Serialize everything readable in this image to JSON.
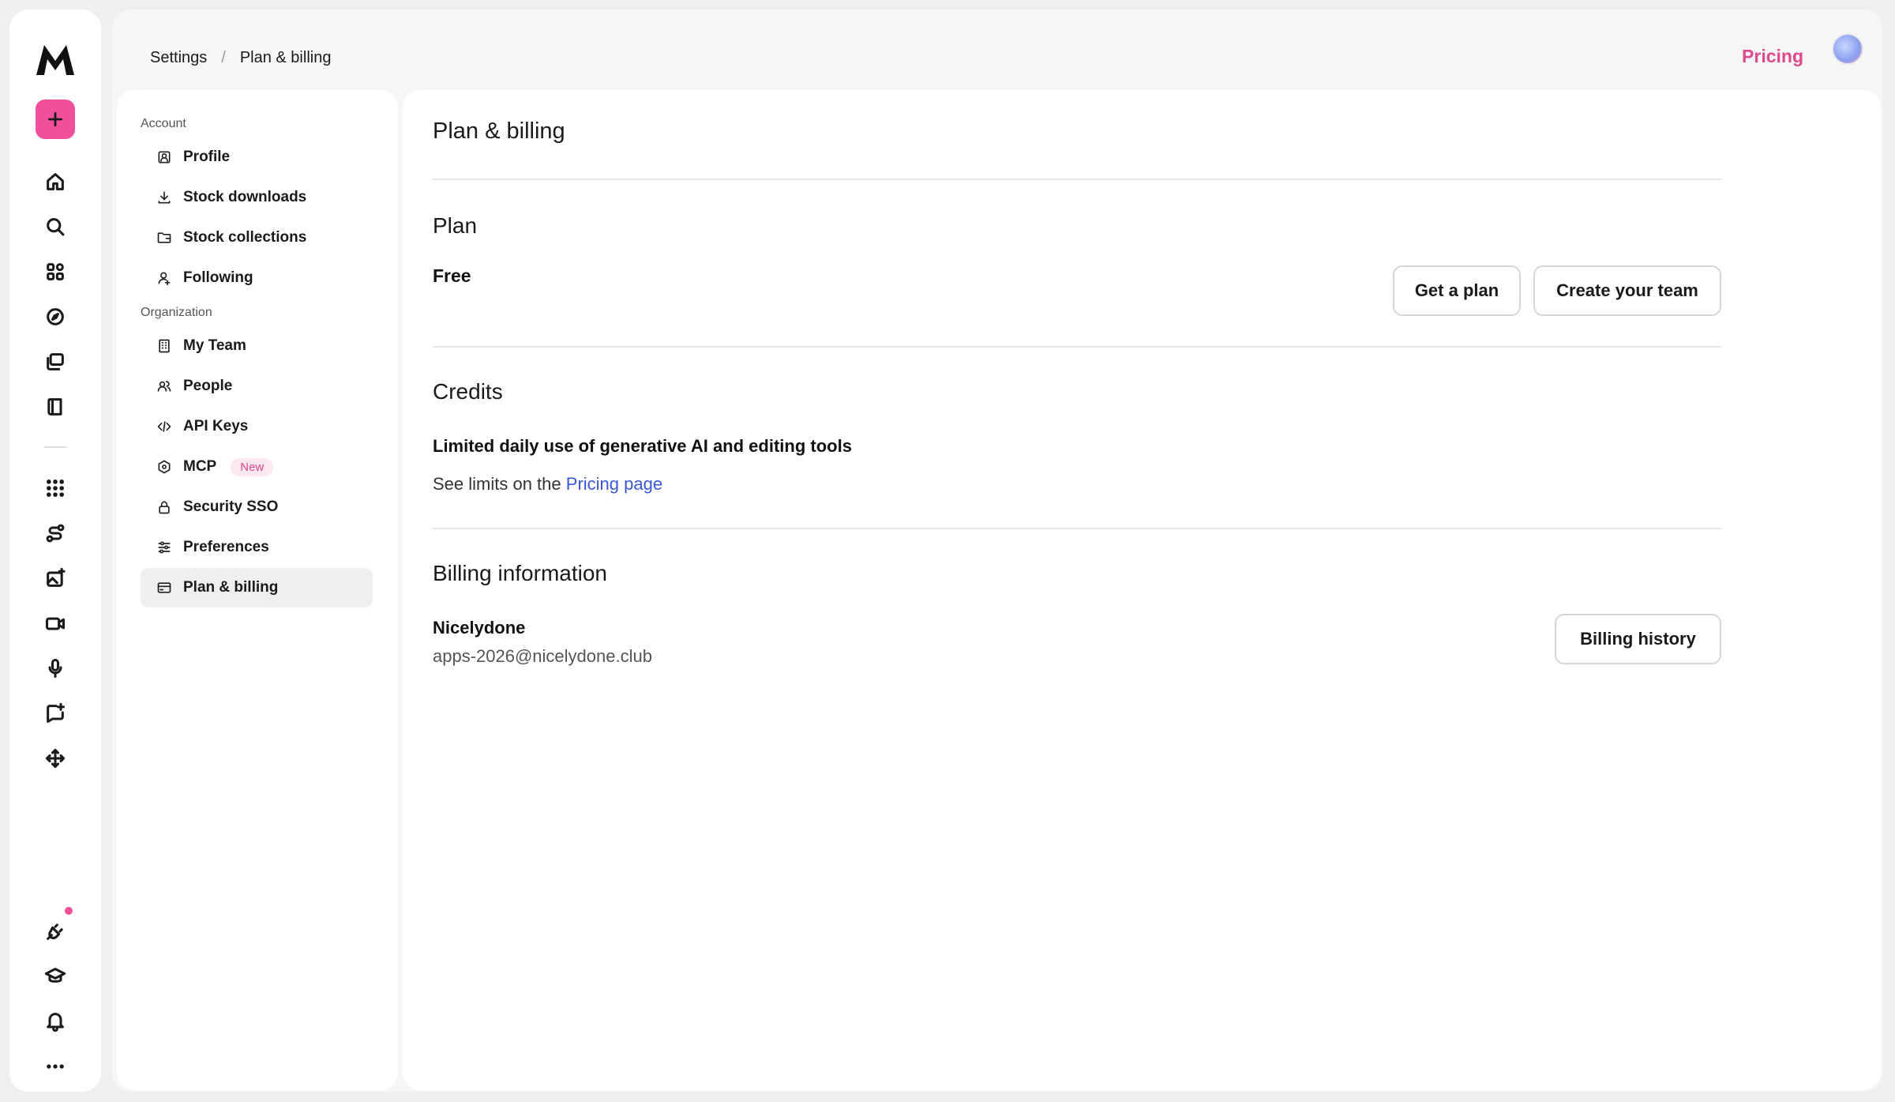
{
  "rail": {
    "top_icons": [
      "home-icon",
      "search-icon",
      "apps-grid-icon",
      "compass-icon",
      "collections-icon",
      "book-icon"
    ],
    "tool_icons": [
      "grid-dots-icon",
      "workflow-icon",
      "image-ai-icon",
      "video-ai-icon",
      "microphone-icon",
      "chat-ai-icon",
      "move-icon"
    ],
    "bottom_icons": [
      "plug-icon",
      "graduation-cap-icon",
      "bell-icon",
      "more-icon"
    ],
    "accent_color": "#f0509b"
  },
  "header": {
    "breadcrumb_root": "Settings",
    "breadcrumb_sep": "/",
    "breadcrumb_current": "Plan & billing",
    "pricing_label": "Pricing"
  },
  "subnav": {
    "account_label": "Account",
    "account_items": [
      {
        "label": "Profile",
        "icon": "profile-icon"
      },
      {
        "label": "Stock downloads",
        "icon": "download-icon"
      },
      {
        "label": "Stock collections",
        "icon": "folder-icon"
      },
      {
        "label": "Following",
        "icon": "user-follow-icon"
      }
    ],
    "org_label": "Organization",
    "org_items": [
      {
        "label": "My Team",
        "icon": "building-icon"
      },
      {
        "label": "People",
        "icon": "people-icon"
      },
      {
        "label": "API Keys",
        "icon": "code-icon"
      },
      {
        "label": "MCP",
        "icon": "hexagon-icon",
        "badge": "New"
      },
      {
        "label": "Security SSO",
        "icon": "lock-icon"
      },
      {
        "label": "Preferences",
        "icon": "sliders-icon"
      },
      {
        "label": "Plan & billing",
        "icon": "card-icon",
        "active": true
      }
    ]
  },
  "main": {
    "title": "Plan & billing",
    "plan": {
      "heading": "Plan",
      "current": "Free",
      "get_plan_label": "Get a plan",
      "create_team_label": "Create your team"
    },
    "credits": {
      "heading": "Credits",
      "description": "Limited daily use of generative AI and editing tools",
      "limits_prefix": "See limits on the",
      "limits_link": "Pricing page"
    },
    "billing": {
      "heading": "Billing information",
      "name": "Nicelydone",
      "email": "apps-2026@nicelydone.club",
      "history_label": "Billing history"
    }
  }
}
